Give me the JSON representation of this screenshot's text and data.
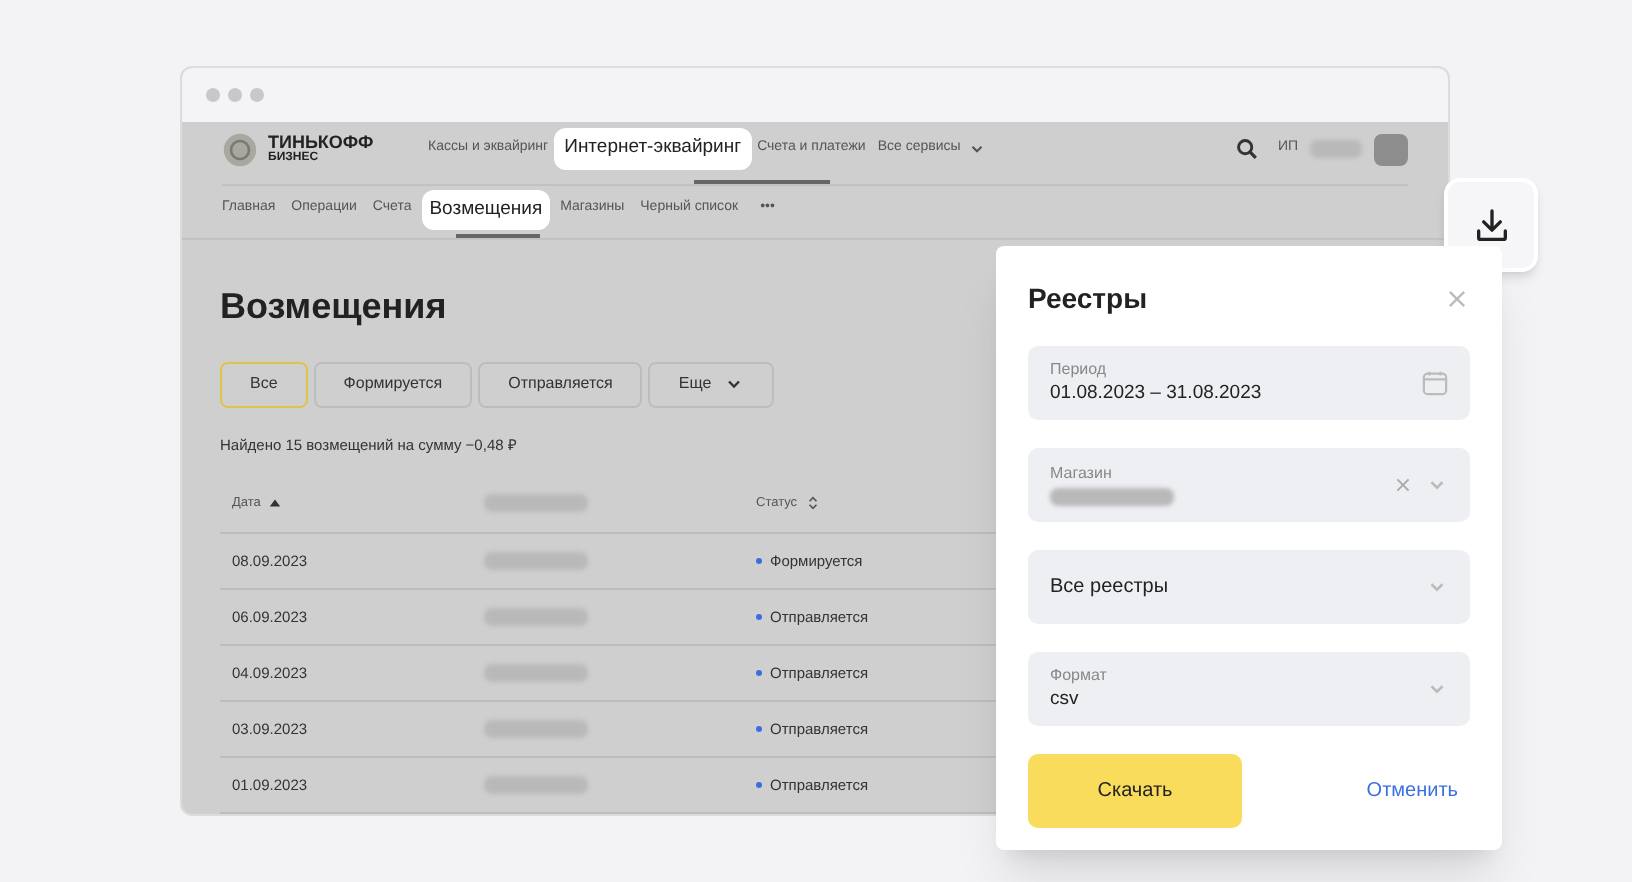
{
  "header": {
    "logo": {
      "line1": "ТИНЬКОФФ",
      "line2": "БИЗНЕС"
    },
    "nav": [
      {
        "label": "Кассы и эквайринг",
        "selected": false
      },
      {
        "label": "Интернет-эквайринг",
        "selected": true
      },
      {
        "label": "Счета и платежи",
        "selected": false
      },
      {
        "label": "Все сервисы",
        "selected": false,
        "kind": "dropdown"
      }
    ],
    "user": {
      "prefix": "ИП",
      "name_redacted": true
    }
  },
  "subnav": {
    "items": [
      {
        "label": "Главная",
        "selected": false
      },
      {
        "label": "Операции",
        "selected": false
      },
      {
        "label": "Счета",
        "selected": false
      },
      {
        "label": "Возмещения",
        "selected": true
      },
      {
        "label": "Магазины",
        "selected": false
      },
      {
        "label": "Черный список",
        "selected": false
      }
    ],
    "more": "•••"
  },
  "page": {
    "title": "Возмещения",
    "filters": [
      {
        "label": "Все",
        "selected": true,
        "kind": "button"
      },
      {
        "label": "Формируется",
        "selected": false,
        "kind": "button"
      },
      {
        "label": "Отправляется",
        "selected": false,
        "kind": "button"
      },
      {
        "label": "Еще",
        "selected": false,
        "kind": "dropdown"
      }
    ],
    "summary": "Найдено 15 возмещений на сумму −0,48 ₽",
    "table": {
      "columns": [
        {
          "label": "Дата",
          "sortable": true,
          "sorted": true
        },
        {
          "redacted": true
        },
        {
          "label": "Статус",
          "sortable": true,
          "sorted": false
        }
      ],
      "rows": [
        {
          "date": "08.09.2023",
          "redacted": true,
          "status": "Формируется"
        },
        {
          "date": "06.09.2023",
          "redacted": true,
          "status": "Отправляется"
        },
        {
          "date": "04.09.2023",
          "redacted": true,
          "status": "Отправляется"
        },
        {
          "date": "03.09.2023",
          "redacted": true,
          "status": "Отправляется"
        },
        {
          "date": "01.09.2023",
          "redacted": true,
          "status": "Отправляется"
        }
      ]
    }
  },
  "dialog": {
    "title": "Реестры",
    "fields": [
      {
        "kind": "date",
        "label": "Период",
        "value": "01.08.2023 – 31.08.2023"
      },
      {
        "kind": "select",
        "label": "Магазин",
        "redacted": true,
        "clearable": true
      },
      {
        "kind": "select",
        "value": "Все реестры"
      },
      {
        "kind": "select",
        "label": "Формат",
        "value": "csv"
      }
    ],
    "primary": "Скачать",
    "secondary": "Отменить"
  }
}
